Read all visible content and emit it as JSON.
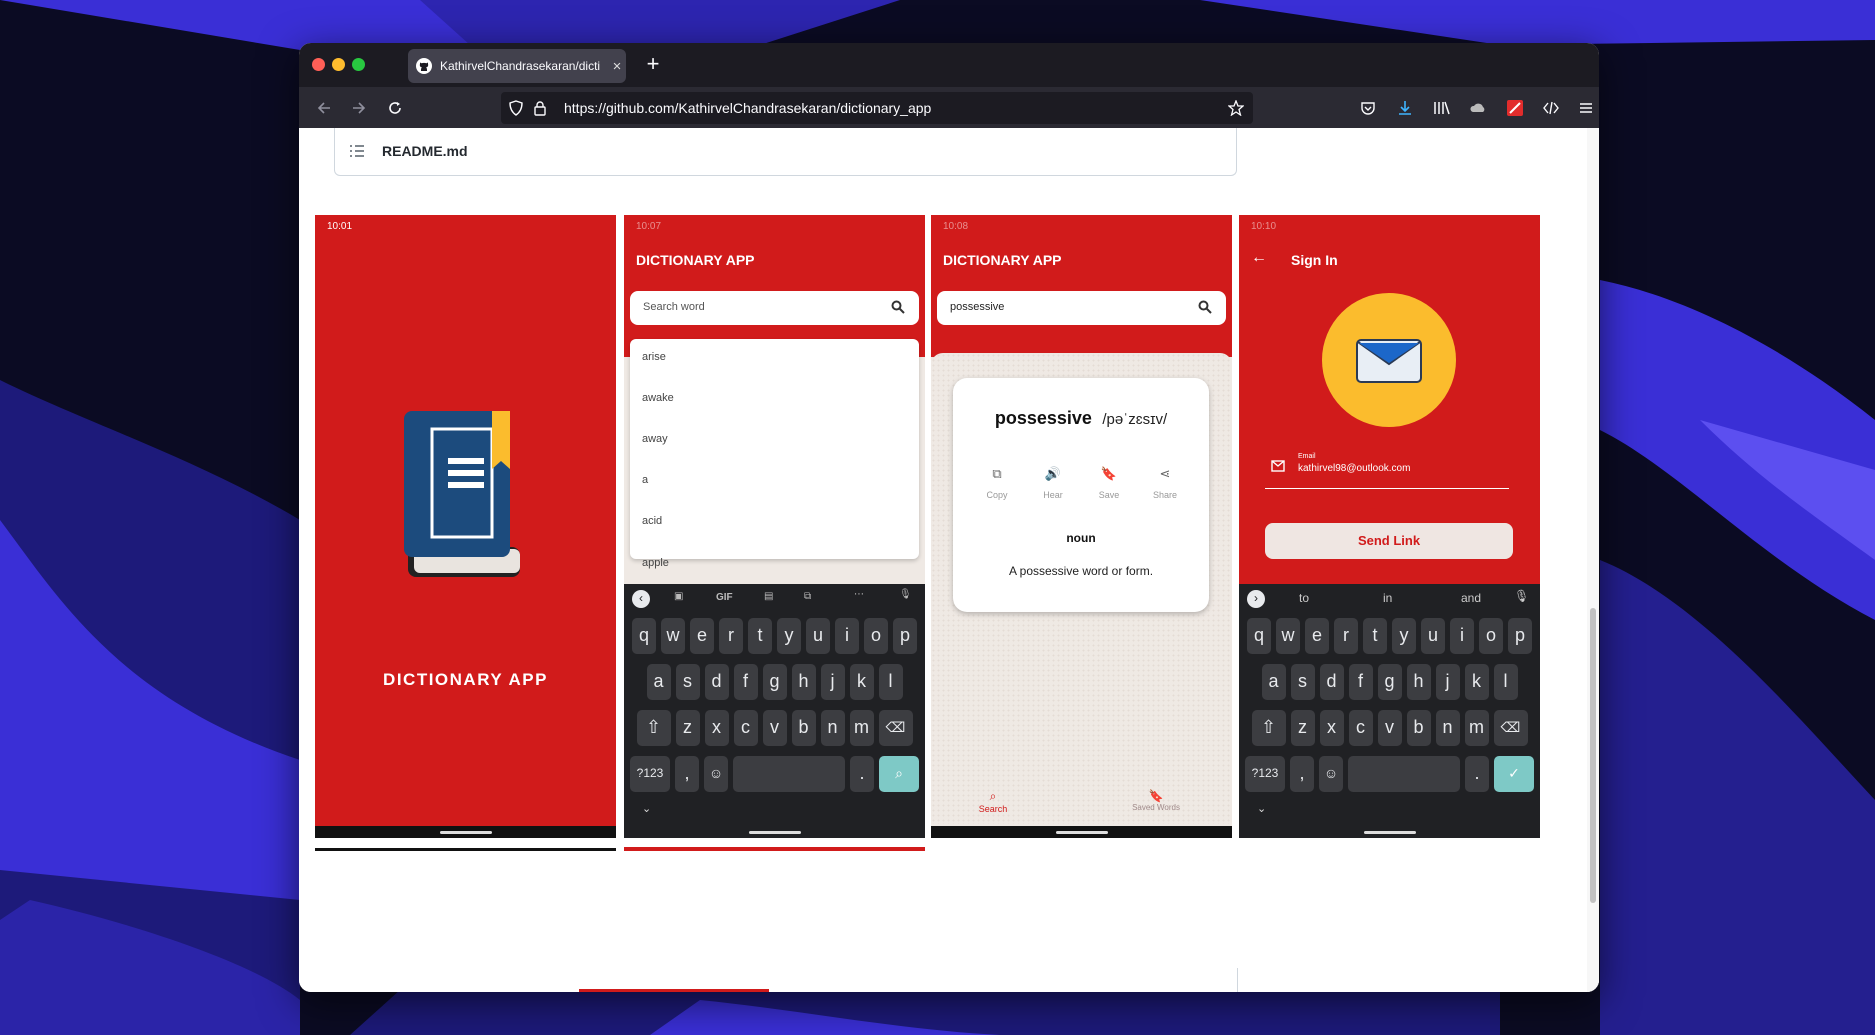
{
  "browser": {
    "tab_title": "KathirvelChandrasekaran/dictio",
    "url": "https://github.com/KathirvelChandrasekaran/dictionary_app"
  },
  "readme": {
    "label": "README.md"
  },
  "screens": {
    "splash": {
      "time": "10:01",
      "title": "DICTIONARY APP"
    },
    "search_list": {
      "time": "10:07",
      "title": "DICTIONARY APP",
      "search_placeholder": "Search word",
      "suggestions": [
        "arise",
        "awake",
        "away",
        "a",
        "acid",
        "apple"
      ]
    },
    "result": {
      "time": "10:08",
      "title": "DICTIONARY APP",
      "search_value": "possessive",
      "word": "possessive",
      "phonetic": "/pəˈzɛsɪv/",
      "actions": [
        "Copy",
        "Hear",
        "Save",
        "Share"
      ],
      "part_of_speech": "noun",
      "definition": "A possessive word or form.",
      "bottom_nav": {
        "search": "Search",
        "saved": "Saved Words"
      }
    },
    "sign_in": {
      "time": "10:10",
      "title": "Sign In",
      "email_label": "Email",
      "email_value": "kathirvel98@outlook.com",
      "send_button": "Send Link",
      "suggestions": [
        "to",
        "in",
        "and"
      ]
    }
  },
  "keyboard": {
    "row1": [
      "q",
      "w",
      "e",
      "r",
      "t",
      "y",
      "u",
      "i",
      "o",
      "p"
    ],
    "row2": [
      "a",
      "s",
      "d",
      "f",
      "g",
      "h",
      "j",
      "k",
      "l"
    ],
    "row3": [
      "z",
      "x",
      "c",
      "v",
      "b",
      "n",
      "m"
    ],
    "symbols_key": "?123",
    "comma": ",",
    "period": ".",
    "gif": "GIF"
  },
  "colors": {
    "brand_red": "#d11b1b",
    "accent_yellow": "#fbbc2d",
    "book_blue": "#1c4b7d",
    "enter_teal": "#7ec9c6"
  }
}
